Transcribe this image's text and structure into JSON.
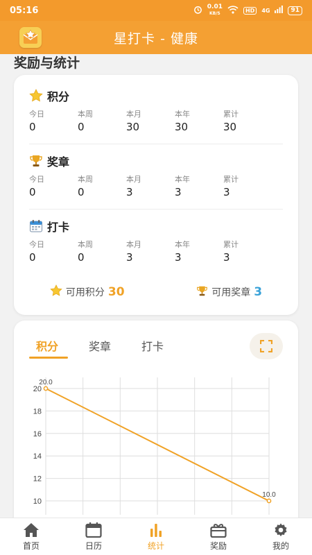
{
  "status_bar": {
    "time": "05:16",
    "speed_value": "0.01",
    "speed_unit": "KB/S",
    "hd": "HD",
    "network": "4G",
    "battery": "91"
  },
  "app": {
    "title": "星打卡 - 健康"
  },
  "section_title": "奖励与统计",
  "stats": {
    "columns": [
      "今日",
      "本周",
      "本月",
      "本年",
      "累计"
    ],
    "groups": [
      {
        "name": "积分",
        "icon": "star-icon",
        "values": [
          "0",
          "0",
          "30",
          "30",
          "30"
        ]
      },
      {
        "name": "奖章",
        "icon": "trophy-icon",
        "values": [
          "0",
          "0",
          "3",
          "3",
          "3"
        ]
      },
      {
        "name": "打卡",
        "icon": "calendar-icon",
        "values": [
          "0",
          "0",
          "3",
          "3",
          "3"
        ]
      }
    ],
    "available_points_label": "可用积分",
    "available_points": "30",
    "available_medals_label": "可用奖章",
    "available_medals": "3"
  },
  "chart_tabs": [
    "积分",
    "奖章",
    "打卡"
  ],
  "chart_data": {
    "type": "line",
    "x": [
      0,
      1
    ],
    "y": [
      20.0,
      10.0
    ],
    "point_labels": [
      "20.0",
      "10.0"
    ],
    "yticks": [
      "10",
      "12",
      "14",
      "16",
      "18",
      "20"
    ],
    "ylim": [
      10,
      20
    ],
    "color": "#f0a226",
    "grid": true
  },
  "nav": [
    {
      "label": "首页",
      "icon": "home-icon",
      "active": false
    },
    {
      "label": "日历",
      "icon": "calendar-icon",
      "active": false
    },
    {
      "label": "统计",
      "icon": "stats-icon",
      "active": true
    },
    {
      "label": "奖励",
      "icon": "gift-icon",
      "active": false
    },
    {
      "label": "我的",
      "icon": "gear-icon",
      "active": false
    }
  ],
  "colors": {
    "header": "#f4a033",
    "accent": "#f0a226",
    "medal_count": "#3aa2d8"
  }
}
